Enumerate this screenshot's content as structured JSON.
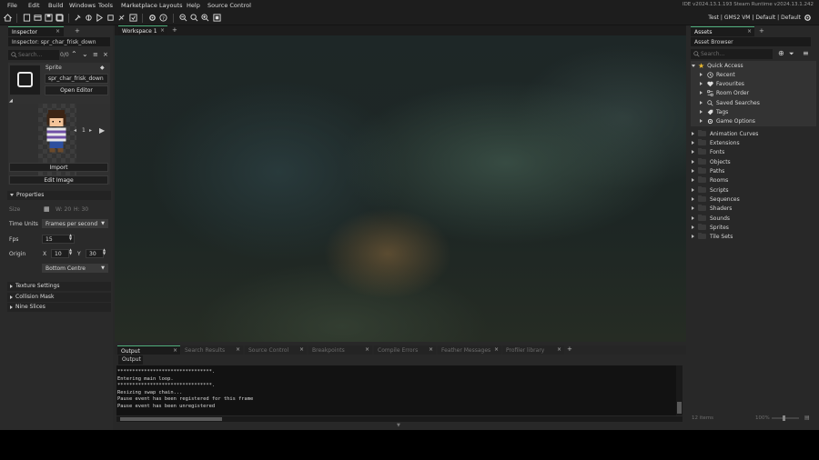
{
  "menubar": {
    "items": [
      "File",
      "Edit",
      "Build",
      "Windows",
      "Tools",
      "Marketplace",
      "Layouts",
      "Help",
      "Source Control"
    ],
    "ide_version": "IDE v2024.13.1.193 Steam  Runtime v2024.13.1.242"
  },
  "toolbar": {
    "target_info": "Test | GMS2 VM | Default | Default"
  },
  "inspector": {
    "tab_label": "Inspector",
    "title": "Inspector: spr_char_frisk_down",
    "search_placeholder": "Search...",
    "search_count": "0/0",
    "resource_type": "Sprite",
    "sprite_name": "spr_char_frisk_down",
    "open_editor_label": "Open Editor",
    "frame_number": "1",
    "import_label": "Import",
    "edit_image_label": "Edit Image",
    "properties_label": "Properties",
    "size_label": "Size",
    "size_w": "W: 20",
    "size_h": "H: 30",
    "time_units_label": "Time Units",
    "time_units_value": "Frames per second",
    "fps_label": "Fps",
    "fps_value": "15",
    "origin_label": "Origin",
    "origin_x_label": "X",
    "origin_x": "10",
    "origin_y_label": "Y",
    "origin_y": "30",
    "origin_preset": "Bottom Centre",
    "sections": [
      "Texture Settings",
      "Collision Mask",
      "Nine Slices"
    ]
  },
  "workspace": {
    "tab_label": "Workspace 1"
  },
  "output": {
    "tabs": [
      "Output",
      "Search Results",
      "Source Control",
      "Breakpoints",
      "Compile Errors",
      "Feather Messages",
      "Profiler library"
    ],
    "sub_label": "Output",
    "lines": [
      "********************************.",
      "Entering main loop.",
      "********************************.",
      "Resizing swap chain...",
      "Pause event has been registered for this frame",
      "Pause event has been unregistered"
    ]
  },
  "assets": {
    "tab_label": "Assets",
    "browser_label": "Asset Browser",
    "search_placeholder": "Search...",
    "quick_access_label": "Quick Access",
    "quick_access_items": [
      {
        "label": "Recent",
        "icon": "clock-icon"
      },
      {
        "label": "Favourites",
        "icon": "heart-icon"
      },
      {
        "label": "Room Order",
        "icon": "room-order-icon"
      },
      {
        "label": "Saved Searches",
        "icon": "search-icon"
      },
      {
        "label": "Tags",
        "icon": "tag-icon"
      },
      {
        "label": "Game Options",
        "icon": "gear-icon"
      }
    ],
    "folders": [
      "Animation Curves",
      "Extensions",
      "Fonts",
      "Objects",
      "Paths",
      "Rooms",
      "Scripts",
      "Sequences",
      "Shaders",
      "Sounds",
      "Sprites",
      "Tile Sets"
    ],
    "item_count": "12 items",
    "zoom": "100%"
  },
  "colors": {
    "accent": "#4fae7c",
    "star": "#e9b930",
    "background": "#282828"
  }
}
